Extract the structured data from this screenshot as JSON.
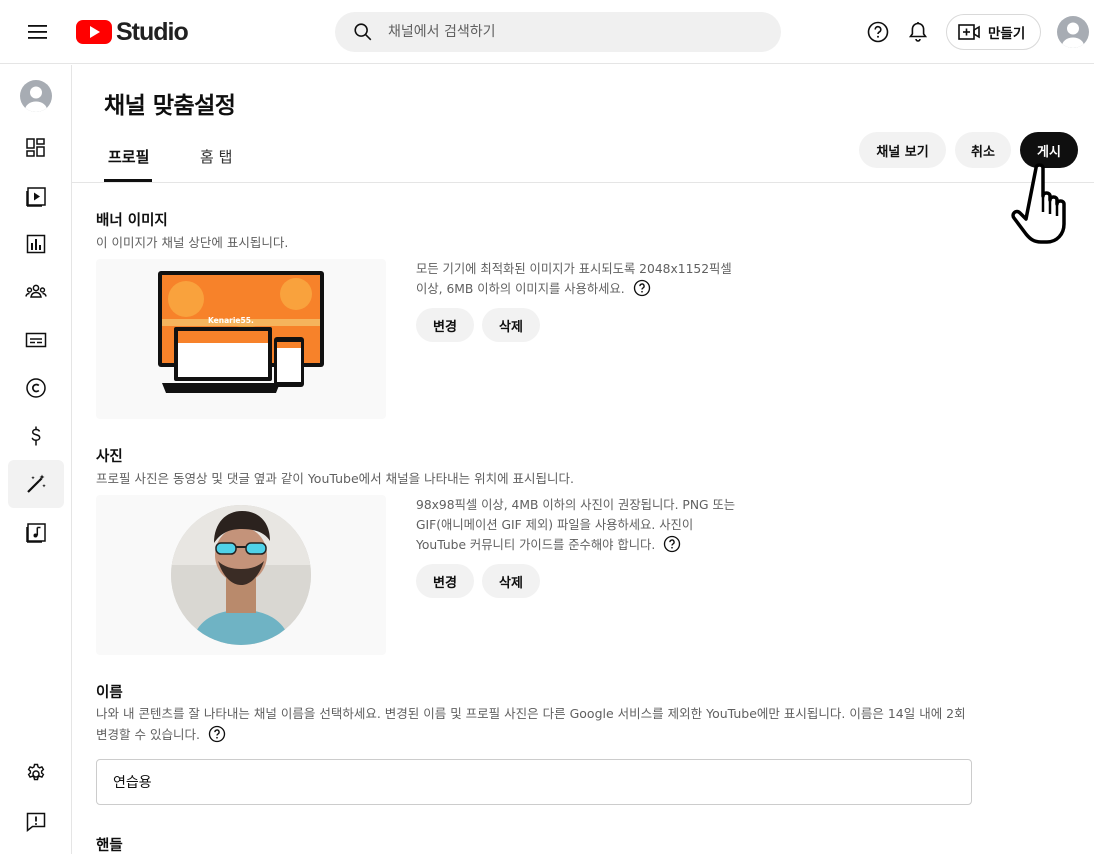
{
  "header": {
    "logo_text": "Studio",
    "search_placeholder": "채널에서 검색하기",
    "create_label": "만들기"
  },
  "page": {
    "title": "채널 맞춤설정",
    "tabs": [
      {
        "label": "프로필",
        "active": true
      },
      {
        "label": "홈 탭",
        "active": false
      }
    ],
    "actions": {
      "view_channel": "채널 보기",
      "cancel": "취소",
      "publish": "게시"
    }
  },
  "banner": {
    "title": "배너 이미지",
    "description": "이 이미지가 채널 상단에 표시됩니다.",
    "info_line1": "모든 기기에 최적화된 이미지가 표시되도록 2048x1152픽셀",
    "info_line2": "이상, 6MB 이하의 이미지를 사용하세요.",
    "preview_text": "Kenarie55.",
    "change_label": "변경",
    "delete_label": "삭제"
  },
  "photo": {
    "title": "사진",
    "description": "프로필 사진은 동영상 및 댓글 옆과 같이 YouTube에서 채널을 나타내는 위치에 표시됩니다.",
    "info_line1": "98x98픽셀 이상, 4MB 이하의 사진이 권장됩니다. PNG 또는",
    "info_line2": "GIF(애니메이션 GIF 제외) 파일을 사용하세요. 사진이",
    "info_line3": "YouTube 커뮤니티 가이드를 준수해야 합니다.",
    "change_label": "변경",
    "delete_label": "삭제"
  },
  "name": {
    "title": "이름",
    "description_line1": "나와 내 콘텐츠를 잘 나타내는 채널 이름을 선택하세요. 변경된 이름 및 프로필 사진은 다른 Google 서비스를 제외한 YouTube에만 표시됩니다. 이름은 14일 내에 2회",
    "description_line2": "변경할 수 있습니다.",
    "value": "연습용"
  },
  "handle": {
    "title": "핸들"
  },
  "colors": {
    "youtube_red": "#ff0000",
    "text_primary": "#0f0f0f",
    "text_secondary": "#606060",
    "pill_bg": "#f2f2f2",
    "banner_orange": "#f7822a"
  },
  "sidebar": {
    "items": [
      {
        "icon": "dashboard-icon"
      },
      {
        "icon": "content-icon"
      },
      {
        "icon": "analytics-icon"
      },
      {
        "icon": "community-icon"
      },
      {
        "icon": "subtitles-icon"
      },
      {
        "icon": "copyright-icon"
      },
      {
        "icon": "monetization-icon"
      },
      {
        "icon": "customization-icon",
        "active": true
      },
      {
        "icon": "audio-library-icon"
      },
      {
        "icon": "settings-icon"
      },
      {
        "icon": "feedback-icon"
      }
    ]
  }
}
